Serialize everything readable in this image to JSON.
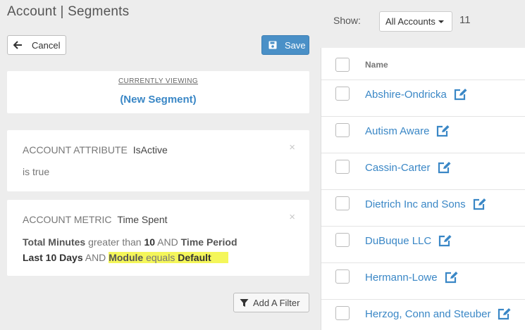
{
  "header": {
    "title": "Account | Segments"
  },
  "toolbar": {
    "cancel_label": "Cancel",
    "save_label": "Save"
  },
  "viewing": {
    "label": "CURRENTLY VIEWING",
    "segment_name": "(New Segment)"
  },
  "filters": [
    {
      "type": "ACCOUNT ATTRIBUTE",
      "name": "IsActive",
      "condition": "is true",
      "close": "×"
    },
    {
      "type": "ACCOUNT METRIC",
      "name": "Time Spent",
      "close": "×",
      "parts": {
        "p1": "Total Minutes",
        "p2": " greater than ",
        "p3": "10",
        "p4": " AND ",
        "p5": "Time Period",
        "p6": "Last 10 Days",
        "p7": " AND ",
        "p8": "Module",
        "p9": " equals ",
        "p10": "Default"
      }
    }
  ],
  "add_filter_label": "Add A Filter",
  "show": {
    "label": "Show:",
    "selected": "All Accounts",
    "count": "11"
  },
  "table": {
    "column_name": "Name",
    "rows": [
      {
        "name": "Abshire-Ondricka"
      },
      {
        "name": "Autism Aware"
      },
      {
        "name": "Cassin-Carter"
      },
      {
        "name": "Dietrich Inc and Sons"
      },
      {
        "name": "DuBuque LLC"
      },
      {
        "name": "Hermann-Lowe"
      },
      {
        "name": "Herzog, Conn and Steuber"
      }
    ]
  },
  "colors": {
    "accent": "#3a87c6",
    "save": "#4a90c7",
    "highlight": "#f4f65a",
    "background": "#ededed"
  },
  "icons": {
    "cancel": "arrow-left-icon",
    "save": "floppy-disk-icon",
    "filter": "funnel-icon",
    "edit": "edit-icon",
    "close": "close-icon"
  }
}
